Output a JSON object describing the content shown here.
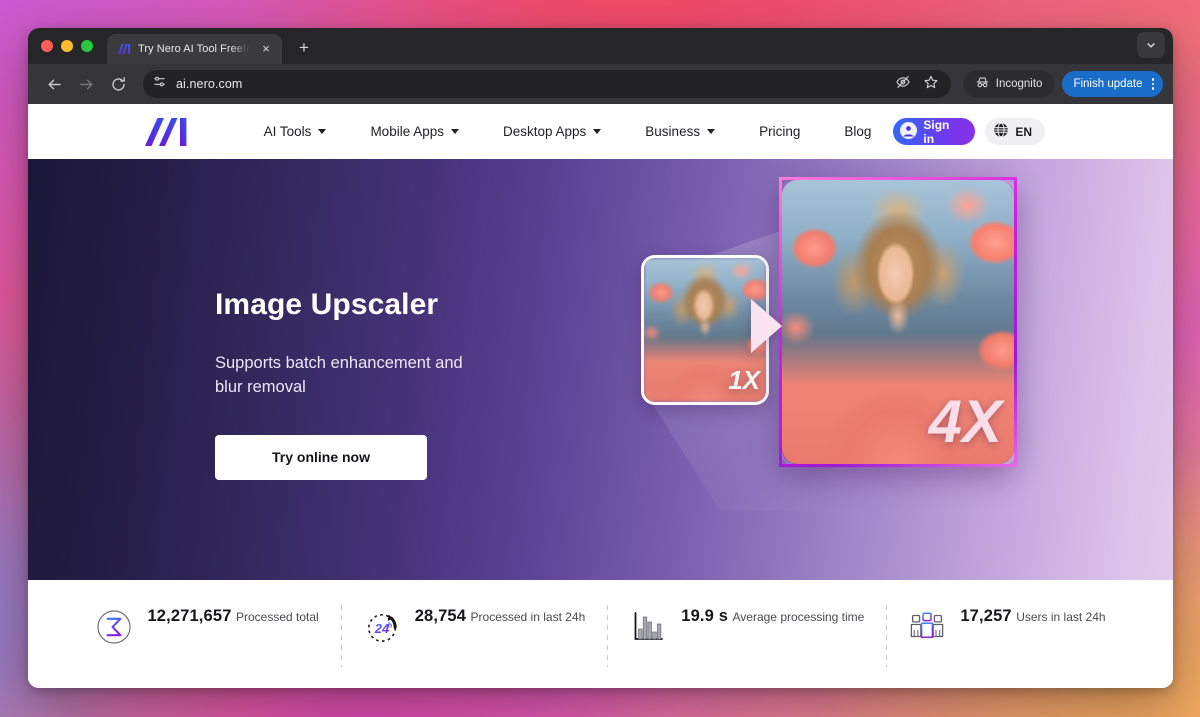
{
  "browser": {
    "tab": {
      "title": "Try Nero AI Tool Free!#Enlarge",
      "favicon": "nero-ai-logo-icon",
      "close_label": "×"
    },
    "new_tab_label": "+",
    "nav": {
      "back_icon": "arrow-left-icon",
      "forward_icon": "arrow-right-icon",
      "reload_icon": "reload-icon"
    },
    "omnibox": {
      "url": "ai.nero.com",
      "site_settings_icon": "tune-sliders-icon",
      "tracking_icon": "eye-crossed-icon",
      "bookmark_icon": "star-icon"
    },
    "incognito_label": "Incognito",
    "update_label": "Finish update",
    "menu_icon": "kebab-menu-icon",
    "tabstrip_expand_icon": "chevron-down-icon"
  },
  "site": {
    "logo_text": "AI",
    "nav": [
      {
        "label": "AI Tools",
        "has_caret": true
      },
      {
        "label": "Mobile Apps",
        "has_caret": true
      },
      {
        "label": "Desktop Apps",
        "has_caret": true
      },
      {
        "label": "Business",
        "has_caret": true
      },
      {
        "label": "Pricing",
        "has_caret": false
      },
      {
        "label": "Blog",
        "has_caret": false
      }
    ],
    "signin_label": "Sign in",
    "signin_icon": "user-avatar-icon",
    "lang_label": "EN",
    "lang_icon": "globe-icon"
  },
  "hero": {
    "title": "Image Upscaler",
    "subtitle": "Supports batch enhancement and blur removal",
    "cta_label": "Try online now",
    "before_badge": "1X",
    "after_badge": "4X",
    "arrow_icon": "play-arrow-icon",
    "before_image_alt": "woman-with-curly-hair-and-flowers-low-resolution",
    "after_image_alt": "woman-with-curly-hair-and-flowers-upscaled"
  },
  "stats": [
    {
      "icon": "sigma-sum-icon",
      "value": "12,271,657",
      "label": "Processed total"
    },
    {
      "icon": "clock-24h-icon",
      "value": "28,754",
      "label": "Processed in last 24h"
    },
    {
      "icon": "bar-chart-icon",
      "value": "19.9 s",
      "label": "Average processing time"
    },
    {
      "icon": "users-group-icon",
      "value": "17,257",
      "label": "Users in last 24h"
    }
  ],
  "colors": {
    "brand_purple": "#7b2fe0",
    "brand_blue": "#2f6bf5",
    "update_blue": "#1a6cc9",
    "hero_dark": "#1b1738",
    "hero_light": "#e2cbec",
    "frame_pink": "#d31fe2"
  }
}
